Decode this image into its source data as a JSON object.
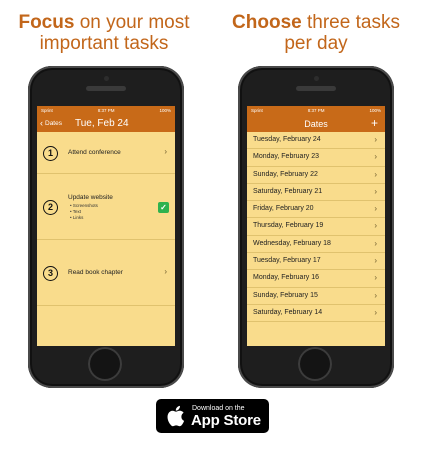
{
  "headlines": {
    "left": {
      "emphasis": "Focus",
      "rest": " on your most important tasks"
    },
    "right": {
      "emphasis": "Choose",
      "rest": " three tasks per day"
    }
  },
  "status_bar": {
    "carrier": "Sprint",
    "time": "8:37 PM",
    "battery": "100%"
  },
  "left_screen": {
    "back_label": "Dates",
    "title": "Tue, Feb 24",
    "tasks": [
      {
        "number": "1",
        "title": "Attend conference",
        "subs": [],
        "done": false
      },
      {
        "number": "2",
        "title": "Update website",
        "subs": [
          "Screenshots",
          "Text",
          "Links"
        ],
        "done": true
      },
      {
        "number": "3",
        "title": "Read book chapter",
        "subs": [],
        "done": false
      }
    ]
  },
  "right_screen": {
    "title": "Dates",
    "add_label": "+",
    "dates": [
      "Tuesday, February 24",
      "Monday, February 23",
      "Sunday, February 22",
      "Saturday, February 21",
      "Friday, February 20",
      "Thursday, February 19",
      "Wednesday, February 18",
      "Tuesday, February 17",
      "Monday, February 16",
      "Sunday, February 15",
      "Saturday, February 14"
    ]
  },
  "app_store_badge": {
    "line1": "Download on the",
    "line2": "App Store"
  },
  "colors": {
    "accent": "#c2661a",
    "navbar": "#c86a18",
    "screen_bg": "#f9dc8c",
    "check": "#2fb24e"
  }
}
